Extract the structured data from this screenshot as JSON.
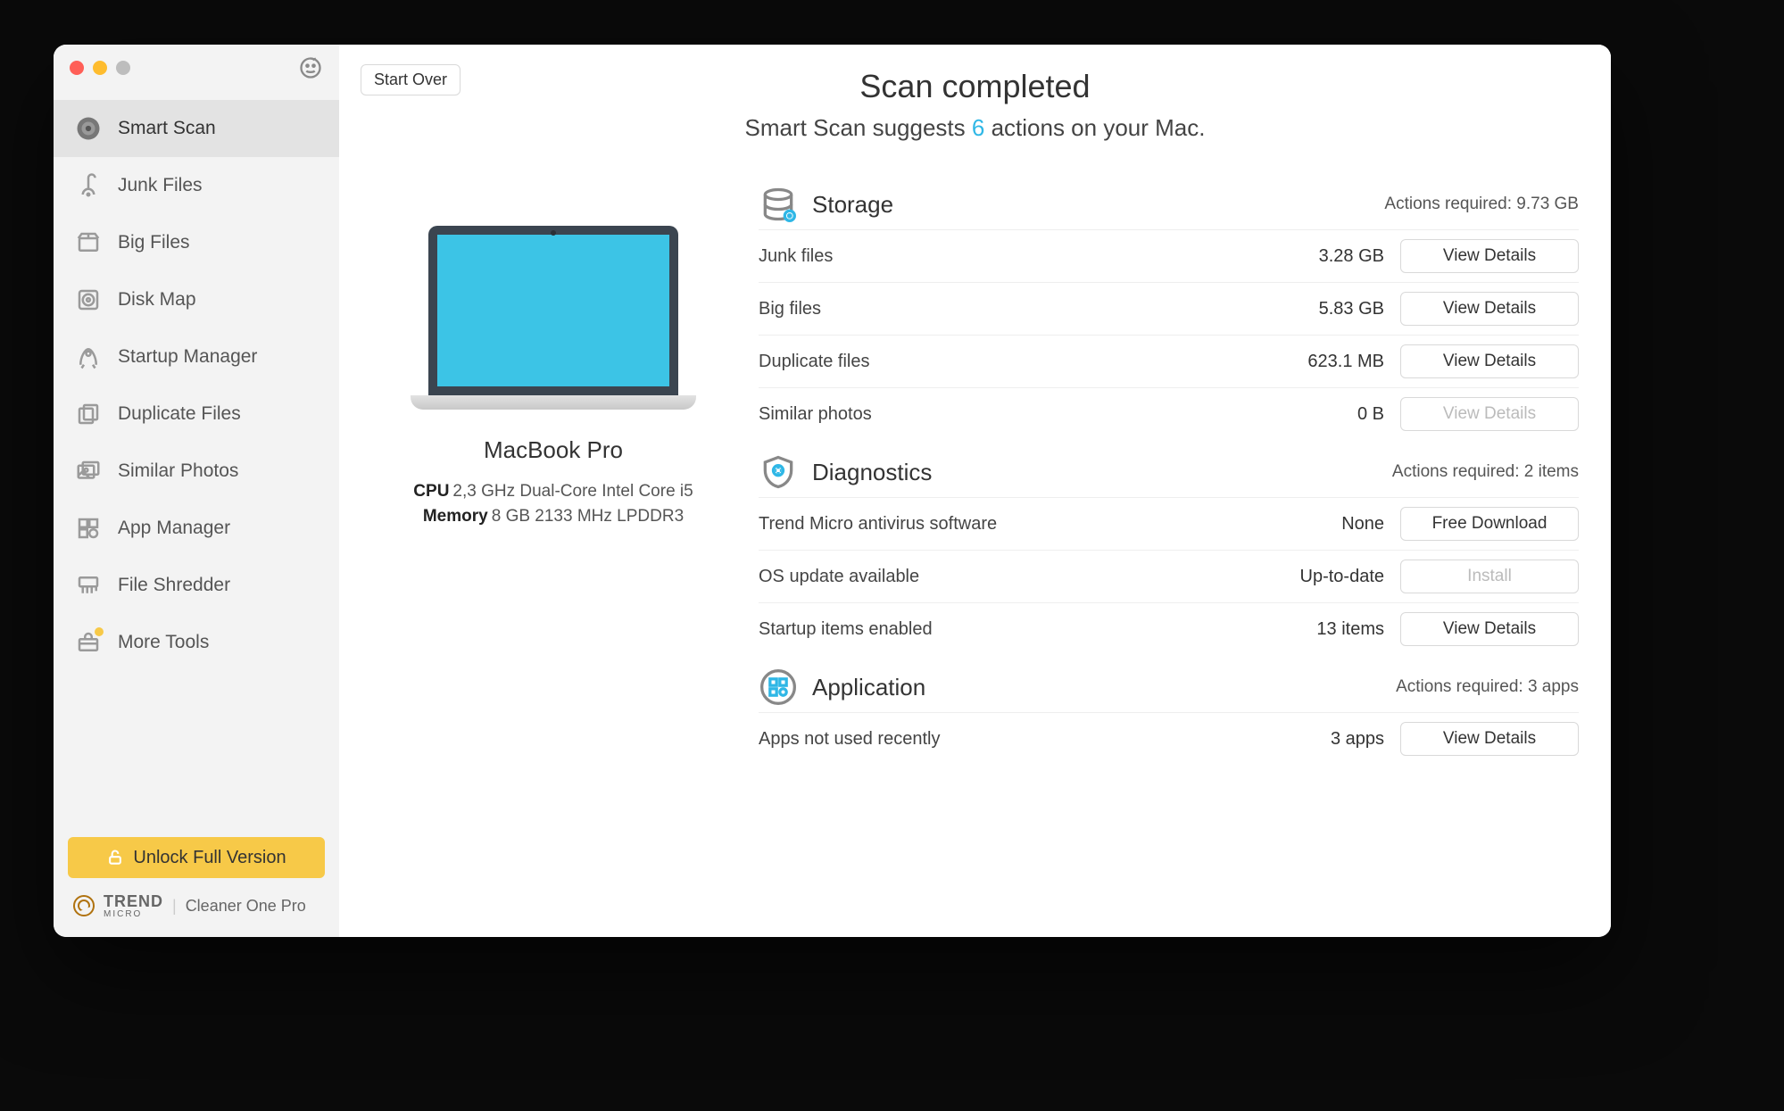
{
  "sidebar": {
    "items": [
      {
        "label": "Smart Scan"
      },
      {
        "label": "Junk Files"
      },
      {
        "label": "Big Files"
      },
      {
        "label": "Disk Map"
      },
      {
        "label": "Startup Manager"
      },
      {
        "label": "Duplicate Files"
      },
      {
        "label": "Similar Photos"
      },
      {
        "label": "App Manager"
      },
      {
        "label": "File Shredder"
      },
      {
        "label": "More Tools"
      }
    ],
    "unlock_label": "Unlock Full Version",
    "brand_primary": "TREND",
    "brand_secondary": "MICRO",
    "product": "Cleaner One Pro"
  },
  "header": {
    "start_over": "Start Over",
    "title": "Scan completed",
    "sub_pre": "Smart Scan suggests ",
    "count": "6",
    "sub_post": " actions on your Mac."
  },
  "device": {
    "name": "MacBook Pro",
    "cpu_label": "CPU",
    "cpu_value": "2,3 GHz Dual-Core Intel Core i5",
    "mem_label": "Memory",
    "mem_value": "8 GB 2133 MHz LPDDR3"
  },
  "storage": {
    "title": "Storage",
    "required": "Actions required: 9.73 GB",
    "rows": [
      {
        "label": "Junk files",
        "value": "3.28 GB",
        "btn": "View Details",
        "enabled": true
      },
      {
        "label": "Big files",
        "value": "5.83 GB",
        "btn": "View Details",
        "enabled": true
      },
      {
        "label": "Duplicate files",
        "value": "623.1 MB",
        "btn": "View Details",
        "enabled": true
      },
      {
        "label": "Similar photos",
        "value": "0 B",
        "btn": "View Details",
        "enabled": false
      }
    ]
  },
  "diagnostics": {
    "title": "Diagnostics",
    "required": "Actions required: 2 items",
    "rows": [
      {
        "label": "Trend Micro antivirus software",
        "value": "None",
        "btn": "Free Download",
        "enabled": true
      },
      {
        "label": "OS update available",
        "value": "Up-to-date",
        "btn": "Install",
        "enabled": false
      },
      {
        "label": "Startup items enabled",
        "value": "13 items",
        "btn": "View Details",
        "enabled": true
      }
    ]
  },
  "application": {
    "title": "Application",
    "required": "Actions required: 3 apps",
    "rows": [
      {
        "label": "Apps not used recently",
        "value": "3 apps",
        "btn": "View Details",
        "enabled": true
      }
    ]
  }
}
